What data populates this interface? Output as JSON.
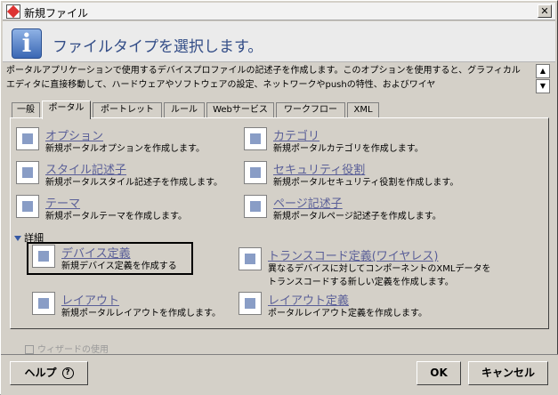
{
  "window": {
    "title": "新規ファイル",
    "close_label": "✕"
  },
  "header": {
    "title": "ファイルタイプを選択します。"
  },
  "description": "ポータルアプリケーションで使用するデバイスプロファイルの記述子を作成します。このオプションを使用すると、グラフィカルエディタに直接移動して、ハードウェアやソフトウェアの設定、ネットワークやpushの特性、およびワイヤ",
  "tabs": [
    {
      "label": "一般"
    },
    {
      "label": "ポータル"
    },
    {
      "label": "ポートレット"
    },
    {
      "label": "ルール"
    },
    {
      "label": "Webサービス"
    },
    {
      "label": "ワークフロー"
    },
    {
      "label": "XML"
    }
  ],
  "items": [
    {
      "name": "オプション",
      "sub": "新規ポータルオプションを作成します。"
    },
    {
      "name": "カテゴリ",
      "sub": "新規ポータルカテゴリを作成します。"
    },
    {
      "name": "スタイル記述子",
      "sub": "新規ポータルスタイル記述子を作成します。"
    },
    {
      "name": "セキュリティ役割",
      "sub": "新規ポータルセキュリティ役割を作成します。"
    },
    {
      "name": "テーマ",
      "sub": "新規ポータルテーマを作成します。"
    },
    {
      "name": "ページ記述子",
      "sub": "新規ポータルページ記述子を作成します。"
    },
    {
      "name": "デバイス定義",
      "sub": "新規デバイス定義を作成する"
    },
    {
      "name": "トランスコード定義(ワイヤレス)",
      "sub": "異なるデバイスに対してコンポーネントのXMLデータを",
      "sub2": "トランスコードする新しい定義を作成します。"
    },
    {
      "name": "レイアウト",
      "sub": "新規ポータルレイアウトを作成します。"
    },
    {
      "name": "レイアウト定義",
      "sub": "ポータルレイアウト定義を作成します。"
    }
  ],
  "details_label": "詳細",
  "wizard_label": "ウィザードの使用",
  "buttons": {
    "help": "ヘルプ",
    "ok": "OK",
    "cancel": "キャンセル"
  }
}
